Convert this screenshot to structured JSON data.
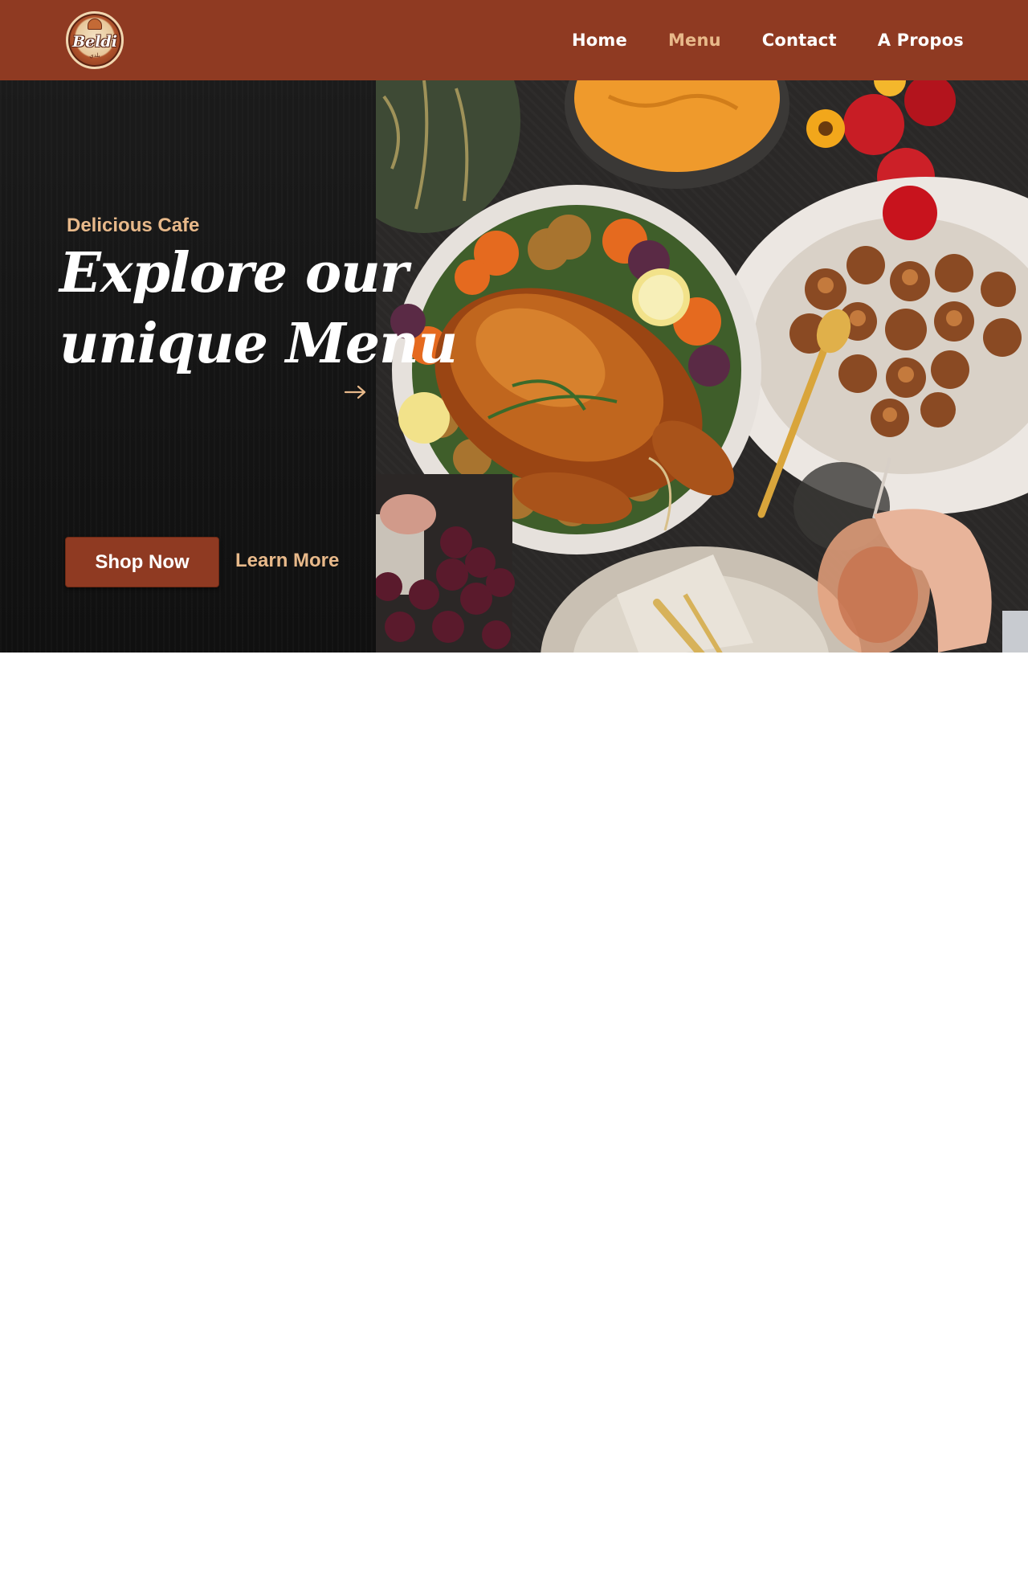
{
  "header": {
    "logo": {
      "text": "Beldi",
      "subtext": "بلدي"
    },
    "nav": [
      {
        "label": "Home",
        "active": false
      },
      {
        "label": "Menu",
        "active": true
      },
      {
        "label": "Contact",
        "active": false
      },
      {
        "label": "A Propos",
        "active": false
      }
    ]
  },
  "hero": {
    "eyebrow": "Delicious Cafe",
    "title_line1": "Explore our",
    "title_line2": "unique Menu",
    "arrow_icon": "arrow-right-icon",
    "primary_button": "Shop Now",
    "secondary_button": "Learn More"
  },
  "colors": {
    "brand": "#8f3a22",
    "accent": "#e8b98a",
    "dark": "#141414",
    "background": "#ffffff"
  }
}
